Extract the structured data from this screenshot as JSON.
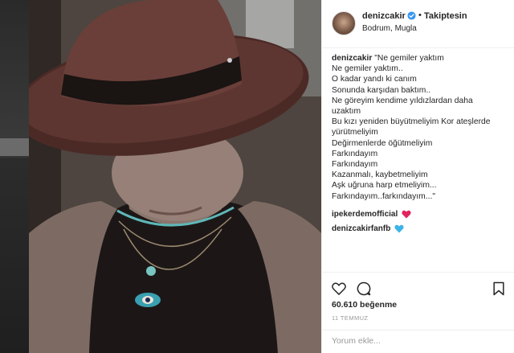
{
  "post": {
    "username": "denizcakir",
    "follow_status": "Takiptesin",
    "location": "Bodrum, Mugla",
    "caption_user": "denizcakir",
    "caption_lines": [
      "\"Ne gemiler yaktım",
      "Ne gemiler yaktım..",
      "O kadar yandı ki canım",
      "Sonunda karşıdan baktım..",
      "Ne göreyim kendime yıldızlardan daha",
      "uzaktım",
      "Bu kızı yeniden büyütmeliyim Kor ateşlerde",
      "yürütmeliyim",
      "Değirmenlerde öğütmeliyim",
      "Farkındayım",
      "Farkındayım",
      "Kazanmalı, kaybetmeliyim",
      "Aşk uğruna harp etmeliyim...",
      "Farkındayım..farkındayım...\""
    ],
    "comments": [
      {
        "user": "ipekerdemofficial",
        "emoji": "red-heart",
        "emoji_color": "#e0245e"
      },
      {
        "user": "denizcakirfanfb",
        "emoji": "blue-heart",
        "emoji_color": "#3cb4e6"
      }
    ],
    "likes": "60.610 beğenme",
    "date": "11 TEMMUZ",
    "comment_placeholder": "Yorum ekle..."
  },
  "icons": {
    "verified": "verified-badge-icon",
    "like": "heart-outline-icon",
    "comment": "comment-bubble-icon",
    "save": "bookmark-icon"
  },
  "colors": {
    "verified": "#3897f0",
    "text": "#262626",
    "muted": "#999999"
  }
}
